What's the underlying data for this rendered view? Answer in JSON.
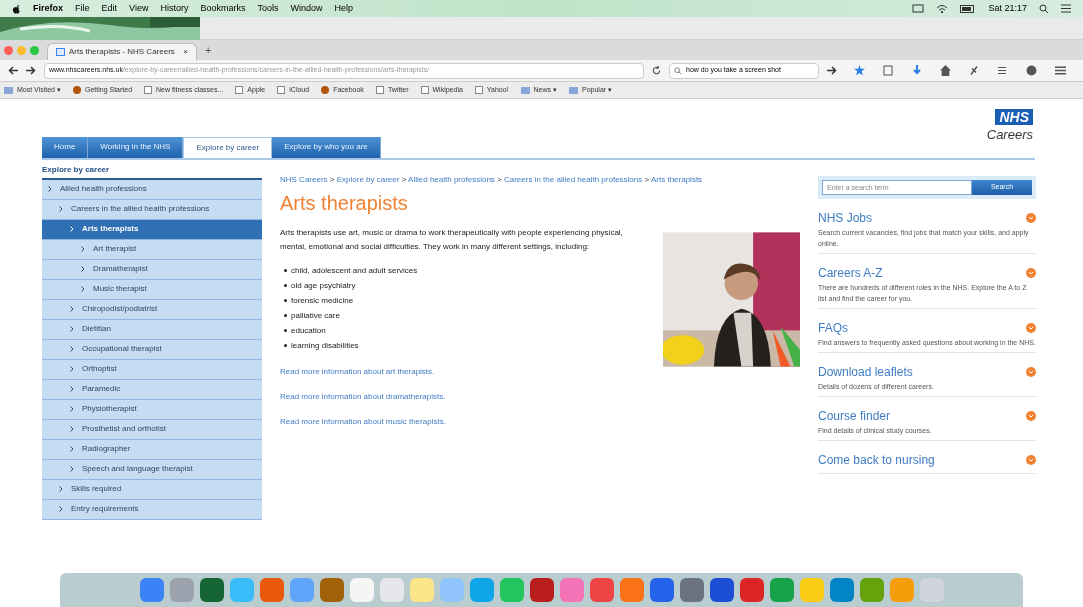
{
  "menu_bar": {
    "app": "Firefox",
    "menus": [
      "File",
      "Edit",
      "View",
      "History",
      "Bookmarks",
      "Tools",
      "Window",
      "Help"
    ],
    "clock": "Sat 21:17"
  },
  "browser": {
    "tabs": [
      {
        "label": "Arts therapists - NHS Careers",
        "close": "×",
        "selected": true
      }
    ],
    "new_tab": "+",
    "url": {
      "host": "www.nhscareers.nhs.uk",
      "path": "/explore-by-career/allied-health-professions/careers-in-the-allied-health-professions/arts-therapists/"
    },
    "search": {
      "value": "how do you take a screen shot"
    },
    "bookmarks": [
      {
        "label": "Most Visited ▾",
        "kind": "folder"
      },
      {
        "label": "Getting Started",
        "kind": "site"
      },
      {
        "label": "New fitness classes...",
        "kind": "page"
      },
      {
        "label": "Apple",
        "kind": "page"
      },
      {
        "label": "iCloud",
        "kind": "page"
      },
      {
        "label": "Facebook",
        "kind": "site"
      },
      {
        "label": "Twitter",
        "kind": "page"
      },
      {
        "label": "Wikipedia",
        "kind": "page"
      },
      {
        "label": "Yahoo!",
        "kind": "page"
      },
      {
        "label": "News ▾",
        "kind": "folder"
      },
      {
        "label": "Popular ▾",
        "kind": "folder"
      }
    ]
  },
  "site": {
    "logo": {
      "mark": "NHS",
      "sub": "Careers"
    },
    "nav": [
      {
        "label": "Home",
        "selected": false
      },
      {
        "label": "Working in the NHS",
        "selected": false
      },
      {
        "label": "Explore by career",
        "selected": true
      },
      {
        "label": "Explore by who you are",
        "selected": false
      }
    ],
    "sidebar": {
      "title": "Explore by career",
      "items": [
        {
          "label": "Allied health professions",
          "selected": false,
          "children": [
            {
              "label": "Careers in the allied health professions",
              "selected": false,
              "children": [
                {
                  "label": "Arts therapists",
                  "selected": true,
                  "children": [
                    {
                      "label": "Art therapist",
                      "selected": false
                    },
                    {
                      "label": "Dramatherapist",
                      "selected": false
                    },
                    {
                      "label": "Music therapist",
                      "selected": false
                    }
                  ]
                },
                {
                  "label": "Chiropodist/podiatrist",
                  "selected": false
                },
                {
                  "label": "Dietitian",
                  "selected": false
                },
                {
                  "label": "Occupational therapist",
                  "selected": false
                },
                {
                  "label": "Orthoptist",
                  "selected": false
                },
                {
                  "label": "Paramedic",
                  "selected": false
                },
                {
                  "label": "Physiotherapist",
                  "selected": false
                },
                {
                  "label": "Prosthetist and orthotist",
                  "selected": false
                },
                {
                  "label": "Radiographer",
                  "selected": false
                },
                {
                  "label": "Speech and language therapist",
                  "selected": false
                }
              ]
            },
            {
              "label": "Skills required",
              "selected": false
            },
            {
              "label": "Entry requirements",
              "selected": false
            }
          ]
        }
      ]
    },
    "breadcrumb": [
      "NHS Careers",
      "Explore by career",
      "Allied health professions",
      "Careers in the allied health professions",
      "Arts therapists"
    ],
    "separator": ">",
    "heading": "Arts therapists",
    "intro": "Arts therapists use art, music or drama to work therapeutically with people experiencing physical, mental, emotional and social difficulties. They work in many different settings, including:",
    "settings": [
      "child, adolescent and adult services",
      "old age psychiatry",
      "forensic medicine",
      "palliative care",
      "education",
      "learning disabilities"
    ],
    "links": [
      "Read more information about art therapists.",
      "Read more information about dramatherapists.",
      "Read more information about music therapists."
    ],
    "search": {
      "placeholder": "Enter a search term",
      "button": "Search"
    },
    "promos": [
      {
        "title": "NHS Jobs",
        "text": "Search current vacancies, find jobs that match your skills, and apply online."
      },
      {
        "title": "Careers A-Z",
        "text": "There are hundreds of different roles in the NHS. Explore the A to Z list and find the career for you."
      },
      {
        "title": "FAQs",
        "text": "Find answers to frequently asked questions about working in the NHS."
      },
      {
        "title": "Download leaflets",
        "text": "Details of dozens of different careers."
      },
      {
        "title": "Course finder",
        "text": "Find details of clinical study courses."
      },
      {
        "title": "Come back to nursing"
      }
    ]
  },
  "dock": [
    {
      "color": "#3b82f6"
    },
    {
      "color": "#9ca3af"
    },
    {
      "color": "#166534"
    },
    {
      "color": "#38bdf8"
    },
    {
      "color": "#ea580c"
    },
    {
      "color": "#60a5fa"
    },
    {
      "color": "#a16207"
    },
    {
      "color": "#f5f5f5"
    },
    {
      "color": "#e5e7eb"
    },
    {
      "color": "#fde68a"
    },
    {
      "color": "#93c5fd"
    },
    {
      "color": "#0ea5e9"
    },
    {
      "color": "#22c55e"
    },
    {
      "color": "#b91c1c"
    },
    {
      "color": "#f472b6"
    },
    {
      "color": "#ef4444"
    },
    {
      "color": "#f97316"
    },
    {
      "color": "#2563eb"
    },
    {
      "color": "#6b7280"
    },
    {
      "color": "#1d4ed8"
    },
    {
      "color": "#dc2626"
    },
    {
      "color": "#16a34a"
    },
    {
      "color": "#facc15"
    },
    {
      "color": "#0284c7"
    },
    {
      "color": "#65a30d"
    },
    {
      "color": "#f59e0b"
    },
    {
      "color": "#d1d5db"
    }
  ]
}
